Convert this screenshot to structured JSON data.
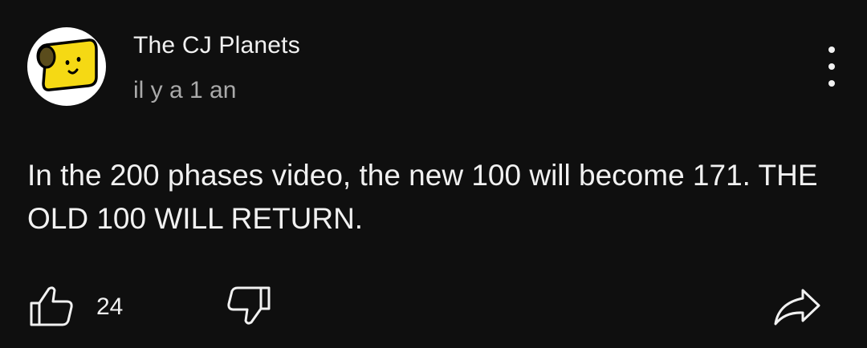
{
  "comment": {
    "author": "The CJ Planets",
    "timestamp": "il y a 1 an",
    "text": "In the 200 phases video, the new 100 will become 171. THE OLD 100 WILL RETURN.",
    "avatar_icon": "yellow-block-character-avatar",
    "more_icon": "vertical-ellipsis-icon"
  },
  "actions": {
    "like_icon": "thumbs-up-icon",
    "like_count": "24",
    "dislike_icon": "thumbs-down-icon",
    "share_icon": "share-arrow-icon"
  },
  "colors": {
    "background": "#0f0f0f",
    "primary_text": "#f1f1f1",
    "secondary_text": "#aaaaaa",
    "avatar_background": "#ffffff",
    "avatar_accent": "#f5d914"
  }
}
